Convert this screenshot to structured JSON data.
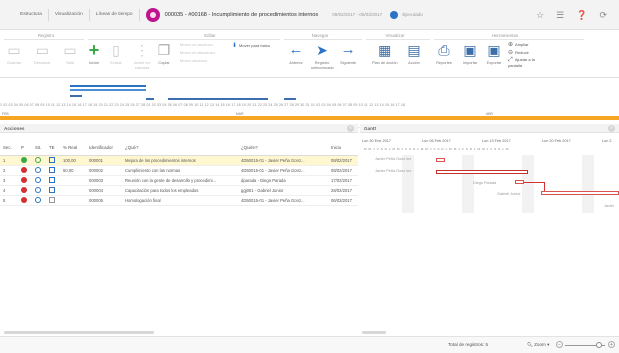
{
  "tabs": {
    "structure": "Estructura",
    "visualization": "Visualización",
    "baseline": "Líneas de tiempo"
  },
  "project": {
    "title": "000035 - #00168 - Incumplimiento de procedimientos internos",
    "dates": "09/02/2017 - 06/03/2017",
    "state": "Ejecutado"
  },
  "top_right_icons": [
    "star-icon",
    "list-icon",
    "help-icon",
    "refresh-icon"
  ],
  "ribbon": {
    "groups": {
      "registro": "Registro",
      "editar": "Editar",
      "navegar": "Navegar",
      "visualizar": "Visualizar",
      "herramientas": "Herramientas"
    },
    "registro_buttons": [
      "Guardar",
      "Deshacer",
      "Salir"
    ],
    "edit_buttons": [
      "Incluir",
      "Excluir",
      "Incluir en cascada",
      "Copiar"
    ],
    "edit_small": [
      "Mover en ascenso",
      "Mover en descenso",
      "Mover ascenso"
    ],
    "move_label": "Mover para baixo",
    "nav_buttons": [
      "Anterior",
      "Registro seleccionado",
      "Siguiente"
    ],
    "view_buttons": [
      "Plan de acción",
      "Acción"
    ],
    "tool_buttons": [
      "Reportes",
      "Importar",
      "Exportar"
    ],
    "tool_small": [
      "Ampliar",
      "Reducir",
      "Ajustar a la pantalla"
    ]
  },
  "overview": {
    "ruler_days": "1 02 03 04 05 06 07 08 09 10 11 12 13 14 15 16 17 18 19 20 21 22 23 24 25 26 27 28 01 02 03 04 05 06 07 08 09 10 11 12 13 14 15 16 17 18 19 20 21 22 23 24 25 26 27 28 29 30 31 01 02 03 04 05 06 07 08 09 10 11 12 13 14 15 16 17 18",
    "month_feb": "FEB",
    "year": "2017",
    "month_mar": "MAR",
    "month_abr": "ABR"
  },
  "activities": {
    "title": "Acciones",
    "columns": [
      "Sec.",
      "P",
      "Sit.",
      "TE",
      "% Real",
      "Identificador",
      "¿Qué?",
      "¿Quién?",
      "Inicio"
    ],
    "rows": [
      {
        "seq": "1",
        "real": "100,00",
        "id": "000001",
        "what": "Mejora de los procedimientos internos",
        "who": "4D50015-01 - Javier Peña Gonz...",
        "start": "08/02/2017"
      },
      {
        "seq": "2",
        "real": "50,00",
        "id": "000002",
        "what": "Cumplimiento con las normas",
        "who": "4D50015-01 - Javier Peña Gonz...",
        "start": "08/02/2017"
      },
      {
        "seq": "3",
        "real": "",
        "id": "000003",
        "what": "Reunión con la gente de desarrollo y procedimi...",
        "who": "dparada - Diego Parada",
        "start": "17/02/2017"
      },
      {
        "seq": "4",
        "real": "",
        "id": "000004",
        "what": "Capacitación para todos los empleados",
        "who": "ggj001 - Gabriel Junior",
        "start": "28/02/2017"
      },
      {
        "seq": "5",
        "real": "",
        "id": "000005",
        "what": "Homologación final",
        "who": "4D50015-01 - Javier Peña Gonz...",
        "start": "06/03/2017"
      }
    ]
  },
  "gantt": {
    "title": "Gantt",
    "weeks": [
      "Lun 30 Ene 2017",
      "Lun 06 Feb 2017",
      "Lun 13 Feb 2017",
      "Lun 20 Feb 2017",
      "Lun 2"
    ],
    "day_letters": "M M J V S D L M M J V S D L M M J V S D L M M J V S D L M M J V S D L M",
    "labels": [
      "Javier Peña Gonz lez",
      "Javier Peña Gonz lez",
      "Diego Parada",
      "Gabriel Junior",
      "Javier"
    ]
  },
  "status": {
    "total": "Total de registros: 5",
    "zoom": "Zoom"
  },
  "colors": {
    "accent": "#2a73c5",
    "project_icon": "#c0148d",
    "today_line": "#f5a623",
    "selected_row": "#fff7cf",
    "gantt_bar": "#d63030"
  }
}
